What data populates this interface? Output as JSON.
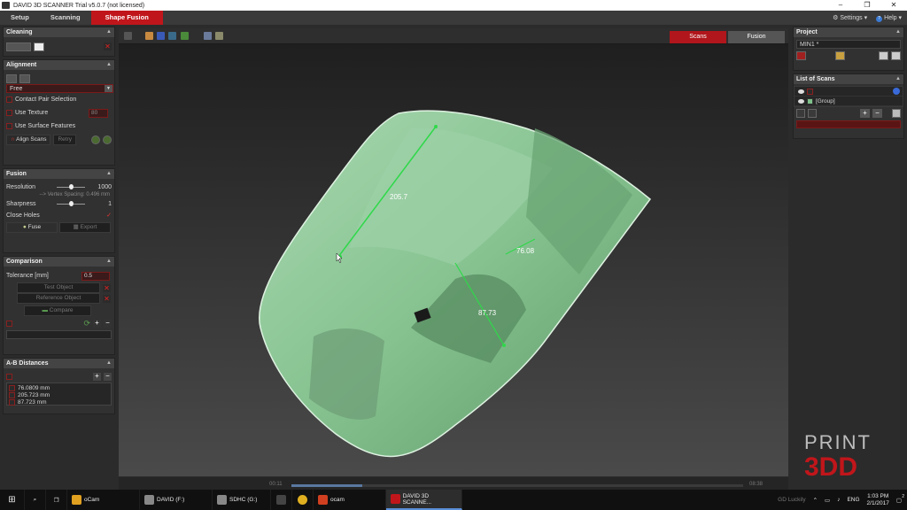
{
  "window": {
    "title": "DAVID 3D SCANNER Trial v5.0.7 (not licensed)",
    "controls": [
      "–",
      "❐",
      "✕"
    ]
  },
  "menubar": {
    "tabs": [
      {
        "label": "Setup"
      },
      {
        "label": "Scanning"
      },
      {
        "label": "Shape Fusion"
      }
    ],
    "settings_label": "Settings ▾",
    "help_label": "Help ▾"
  },
  "cleaning": {
    "title": "Cleaning"
  },
  "alignment": {
    "title": "Alignment",
    "mode": "Free",
    "contact_pair": "Contact Pair Selection",
    "use_texture": "Use Texture",
    "texture_value": "80",
    "use_surface": "Use Surface Features",
    "align_button": "Align Scans",
    "retry_button": "Retry"
  },
  "fusion": {
    "title": "Fusion",
    "resolution_label": "Resolution",
    "resolution_value": "1000",
    "resolution_level": 0.5,
    "vertex_spacing": "--> Vertex Spacing: 0.496 mm",
    "sharpness_label": "Sharpness",
    "sharpness_value": "1",
    "sharpness_level": 0.5,
    "close_holes": "Close Holes",
    "fuse_button": "Fuse",
    "export_button": "Export"
  },
  "comparison": {
    "title": "Comparison",
    "tolerance_label": "Tolerance [mm]",
    "tolerance_value": "0.5",
    "test_object": "Test Object",
    "reference_object": "Reference Object",
    "compare_button": "Compare"
  },
  "distances": {
    "title": "A-B Distances",
    "items": [
      "76.0809 mm",
      "205.723 mm",
      "87.723 mm"
    ]
  },
  "viewport": {
    "scans_button": "Scans",
    "fusion_button": "Fusion",
    "model_color": "#7ec28a",
    "measurements": [
      "205.7",
      "76.08",
      "87.73"
    ]
  },
  "project": {
    "title": "Project",
    "name": "MIN1 *"
  },
  "scanlist": {
    "title": "List of Scans",
    "group_label": "[Group]"
  },
  "timeline": {
    "start": "00:11",
    "end": "08:38"
  },
  "taskbar": {
    "items": [
      {
        "label": "oCam"
      },
      {
        "label": "DAVID (F:)"
      },
      {
        "label": "SDHC (G:)"
      },
      {
        "label": "ocam"
      },
      {
        "label": "DAVID 3D SCANNE..."
      }
    ],
    "tray_text": "GD Luckily",
    "language": "ENG",
    "time": "1:03 PM",
    "date": "2/1/2017",
    "notification_count": "2"
  },
  "watermark": {
    "line1": "PRINT",
    "line2": "3DD"
  }
}
